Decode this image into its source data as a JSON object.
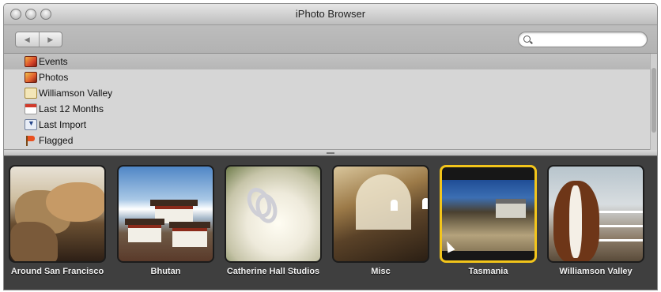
{
  "window": {
    "title": "iPhoto Browser"
  },
  "toolbar": {
    "back_glyph": "◀",
    "forward_glyph": "▶",
    "search_placeholder": ""
  },
  "sources": [
    {
      "label": "Events",
      "icon": "events-icon",
      "selected": true
    },
    {
      "label": "Photos",
      "icon": "photos-icon",
      "selected": false
    },
    {
      "label": "Williamson Valley",
      "icon": "album-icon",
      "selected": false
    },
    {
      "label": "Last 12 Months",
      "icon": "calendar-icon",
      "selected": false
    },
    {
      "label": "Last Import",
      "icon": "import-icon",
      "selected": false
    },
    {
      "label": "Flagged",
      "icon": "flag-icon",
      "selected": false
    }
  ],
  "events": [
    {
      "label": "Around San Francisco",
      "selected": false
    },
    {
      "label": "Bhutan",
      "selected": false
    },
    {
      "label": "Catherine Hall Studios",
      "selected": false
    },
    {
      "label": "Misc",
      "selected": false
    },
    {
      "label": "Tasmania",
      "selected": true
    },
    {
      "label": "Williamson Valley",
      "selected": false
    }
  ],
  "colors": {
    "selection_border": "#f3c51b",
    "grid_background": "#3f3f3f"
  }
}
